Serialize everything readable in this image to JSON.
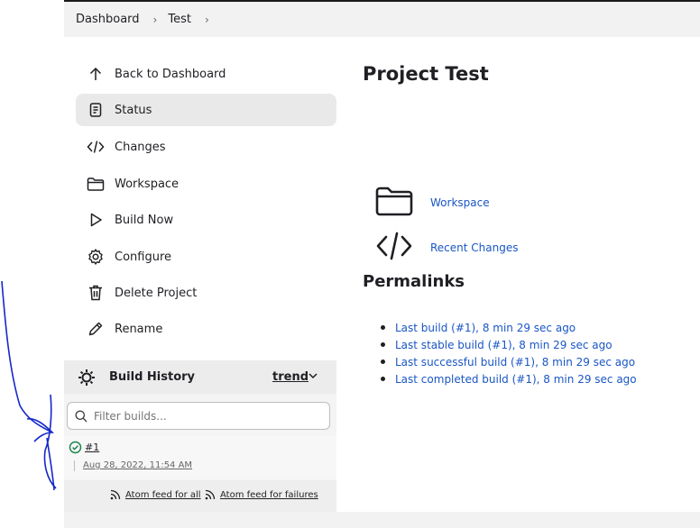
{
  "breadcrumb": {
    "items": [
      "Dashboard",
      "Test"
    ]
  },
  "sidebar": {
    "items": [
      {
        "label": "Back to Dashboard",
        "icon": "arrow-up-icon"
      },
      {
        "label": "Status",
        "icon": "document-icon",
        "active": true
      },
      {
        "label": "Changes",
        "icon": "code-icon"
      },
      {
        "label": "Workspace",
        "icon": "folder-icon"
      },
      {
        "label": "Build Now",
        "icon": "play-icon"
      },
      {
        "label": "Configure",
        "icon": "gear-icon"
      },
      {
        "label": "Delete Project",
        "icon": "trash-icon"
      },
      {
        "label": "Rename",
        "icon": "pencil-icon"
      }
    ]
  },
  "build_history": {
    "title": "Build History",
    "trend_label": "trend",
    "filter_placeholder": "Filter builds...",
    "builds": [
      {
        "number": "#1",
        "date": "Aug 28, 2022, 11:54 AM",
        "status": "success"
      }
    ],
    "feed_all": "Atom feed for all",
    "feed_failures": "Atom feed for failures"
  },
  "main": {
    "title": "Project Test",
    "links": [
      {
        "label": "Workspace",
        "icon": "folder-icon"
      },
      {
        "label": "Recent Changes",
        "icon": "code-icon"
      }
    ],
    "permalinks_title": "Permalinks",
    "permalinks": [
      "Last build (#1), 8 min 29 sec ago",
      "Last stable build (#1), 8 min 29 sec ago",
      "Last successful build (#1), 8 min 29 sec ago",
      "Last completed build (#1), 8 min 29 sec ago"
    ]
  },
  "colors": {
    "link": "#1a56c4",
    "success": "#138347",
    "active_bg": "#e9e9e9",
    "annotation": "#1428c8"
  }
}
